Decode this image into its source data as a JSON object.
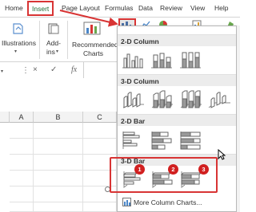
{
  "tabs": {
    "home": "Home",
    "insert": "Insert",
    "page_layout": "Page Layout",
    "formulas": "Formulas",
    "data": "Data",
    "review": "Review",
    "view": "View",
    "help": "Help"
  },
  "ribbon": {
    "illustrations": "Illustrations",
    "addins_line1": "Add-",
    "addins_line2": "ins",
    "recommended_line1": "Recommended",
    "recommended_line2": "Charts"
  },
  "formula_bar": {
    "fx": "fx",
    "cancel": "×",
    "enter": "✓"
  },
  "sheet": {
    "columns": [
      "A",
      "B",
      "C"
    ]
  },
  "dropdown": {
    "section_2d_column": "2-D Column",
    "section_3d_column": "3-D Column",
    "section_2d_bar": "2-D Bar",
    "section_3d_bar": "3-D Bar",
    "more_charts": "More Column Charts..."
  },
  "badges": [
    "1",
    "2",
    "3"
  ],
  "colors": {
    "accent_red": "#d83434",
    "badge_red": "#d11f1f",
    "excel_green": "#1f6b35"
  }
}
